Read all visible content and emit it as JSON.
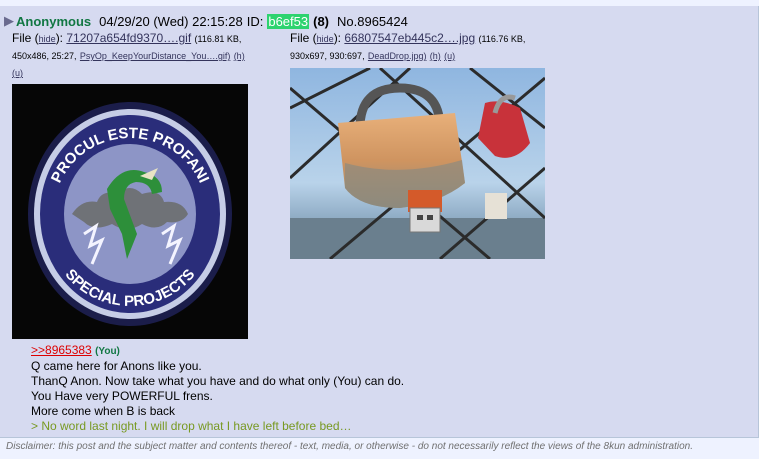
{
  "post": {
    "name": "Anonymous",
    "date": "04/29/20 (Wed) 22:15:28",
    "id_label": "ID:",
    "id_value": "b6ef53",
    "post_count": "(8)",
    "post_number": "No.8965424"
  },
  "files": [
    {
      "prefix": "File (",
      "hide": "hide",
      "mid": "):",
      "filename": "71207a654fd9370….gif",
      "size": "(116.81 KB,",
      "dims": "450x486, 25:27,",
      "orig_name": "PsyOp_KeepYourDistance_You….gif)",
      "h": "(h)",
      "u": "(u)"
    },
    {
      "prefix": "File (",
      "hide": "hide",
      "mid": "):",
      "filename": "66807547eb445c2….jpg",
      "size": "(116.76 KB,",
      "dims": "930x697, 930:697,",
      "orig_name": "DeadDrop.jpg)",
      "h": "(h)",
      "u": "(u)"
    }
  ],
  "patch": {
    "top_text": "PROCUL ESTE PROFANI",
    "bottom_text": "SPECIAL PROJECTS"
  },
  "body": {
    "quote_link": ">>8965383",
    "you": "(You)",
    "lines": [
      "Q came here for Anons like you.",
      "ThanQ Anon. Now take what you have and do what only (You) can do.",
      "You Have very POWERFUL frens.",
      "More come when B is back"
    ],
    "greentext": "> No word last night. I will drop what I have left before bed…"
  },
  "disclaimer": "Disclaimer: this post and the subject matter and contents thereof - text, media, or otherwise - do not necessarily reflect the views of the 8kun administration.",
  "colors": {
    "post_bg": "#d6daf0",
    "name": "#117743",
    "id_bg": "#2dd36f",
    "quote": "#dd0000",
    "greentext": "#789922"
  }
}
